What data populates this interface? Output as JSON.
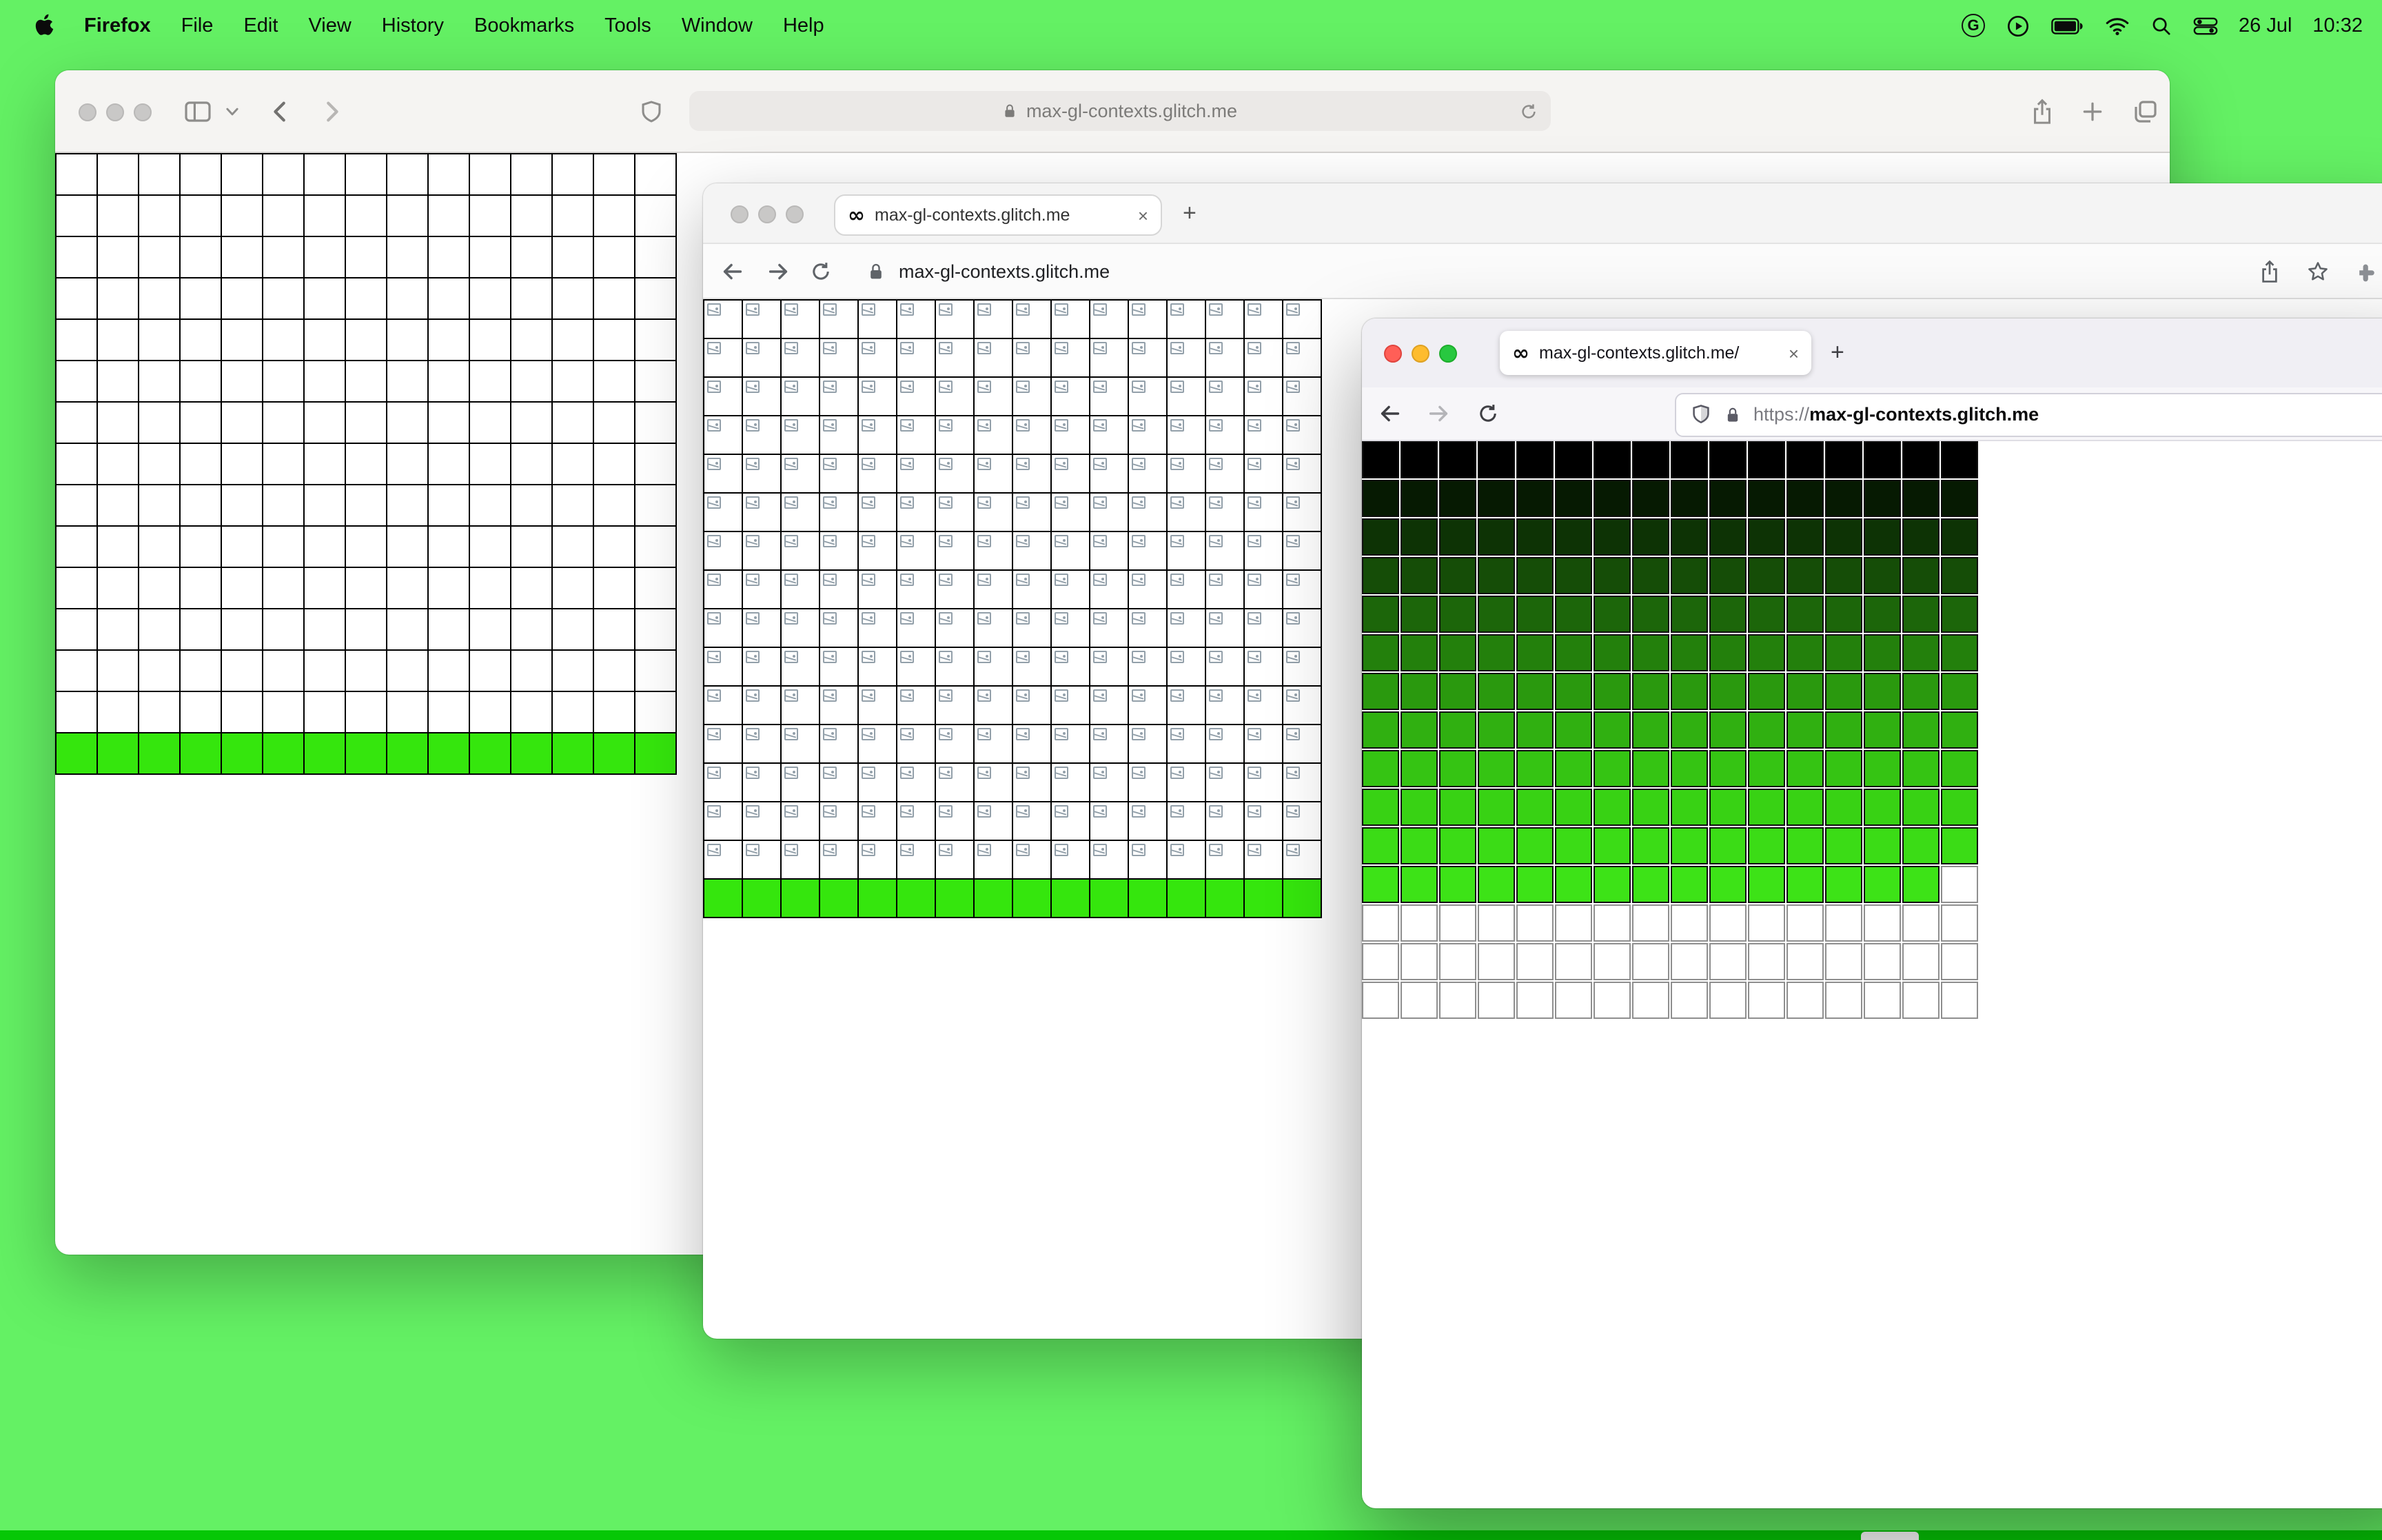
{
  "desktop": {
    "background": "#64f164",
    "bottom_strip": "#06c706"
  },
  "menu_bar": {
    "app_name": "Firefox",
    "menus": [
      "File",
      "Edit",
      "View",
      "History",
      "Bookmarks",
      "Tools",
      "Window",
      "Help"
    ],
    "status": {
      "date": "26 Jul",
      "time": "10:32"
    }
  },
  "glyphs": {
    "infinity": "∞",
    "close": "×",
    "plus": "+",
    "g_logo": "G"
  },
  "safari_window": {
    "url": "max-gl-contexts.glitch.me",
    "grid": {
      "cols": 15,
      "rows": 15,
      "cell_fill": "#ffffff",
      "lattice": "#000000",
      "green_fill": "#35e60d",
      "green_rows": [
        14
      ]
    }
  },
  "chrome_window": {
    "tab_title": "max-gl-contexts.glitch.me",
    "url": "max-gl-contexts.glitch.me",
    "grid": {
      "cols": 16,
      "rows": 16,
      "cell_fill": "#ffffff",
      "lattice": "#000000",
      "green_fill": "#35e60d",
      "green_rows": [
        15
      ],
      "broken_icons": true
    }
  },
  "firefox_window": {
    "tab_title": "max-gl-contexts.glitch.me/",
    "url_scheme": "https://",
    "url_host": "max-gl-contexts.glitch.me",
    "grid": {
      "cols": 16,
      "rows": 15,
      "row_colors": [
        "#000000",
        "#061a02",
        "#0d3305",
        "#154d07",
        "#1c660a",
        "#23800c",
        "#2a990e",
        "#30b011",
        "#35c413",
        "#38d214",
        "#3bdc16",
        "#3de317",
        "#ffffff",
        "#ffffff",
        "#ffffff"
      ],
      "white_cells": [
        [
          11,
          15
        ]
      ],
      "white_border": "#8f8f8f",
      "color_border": "#101010"
    }
  }
}
